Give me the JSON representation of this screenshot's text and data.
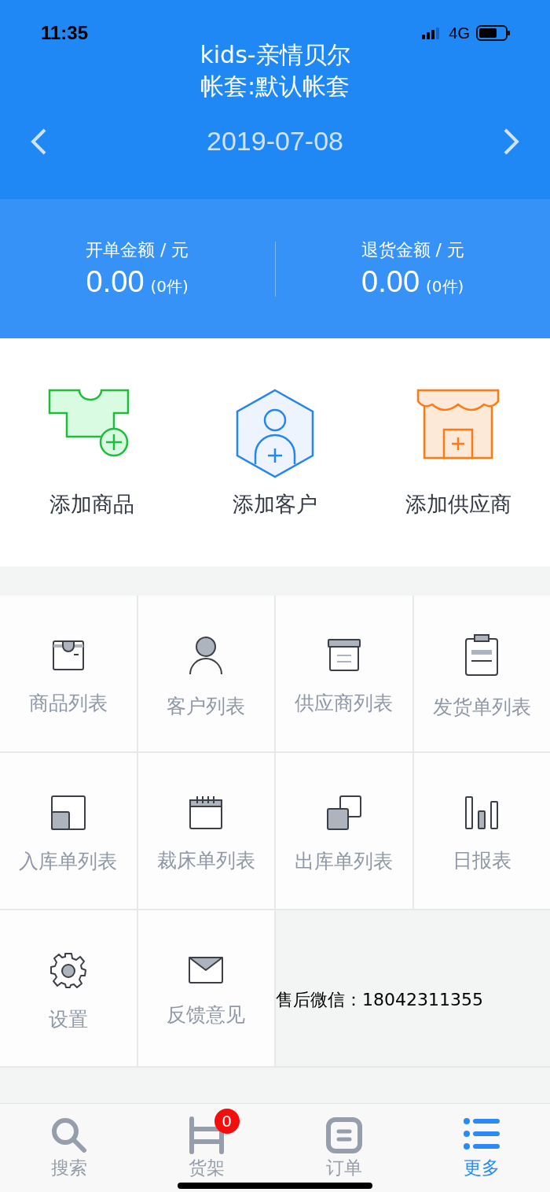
{
  "status_bar": {
    "time": "11:35",
    "network": "4G"
  },
  "header": {
    "title": "kids-亲情贝尔",
    "subtitle": "帐套:默认帐套",
    "date": "2019-07-08"
  },
  "summary": [
    {
      "label": "开单金额 / 元",
      "amount": "0.00",
      "count": "(0件)"
    },
    {
      "label": "退货金额 / 元",
      "amount": "0.00",
      "count": "(0件)"
    }
  ],
  "quick_actions": [
    {
      "kind": "shirt",
      "label": "添加商品"
    },
    {
      "kind": "customer",
      "label": "添加客户"
    },
    {
      "kind": "shop",
      "label": "添加供应商"
    }
  ],
  "menu": [
    {
      "kind": "product",
      "label": "商品列表"
    },
    {
      "kind": "person",
      "label": "客户列表"
    },
    {
      "kind": "archive",
      "label": "供应商列表"
    },
    {
      "kind": "clipboard",
      "label": "发货单列表"
    },
    {
      "kind": "inbound",
      "label": "入库单列表"
    },
    {
      "kind": "calendar",
      "label": "裁床单列表"
    },
    {
      "kind": "outbound",
      "label": "出库单列表"
    },
    {
      "kind": "bars",
      "label": "日报表"
    },
    {
      "kind": "gear",
      "label": "设置"
    },
    {
      "kind": "mail",
      "label": "反馈意见"
    }
  ],
  "contact": "售后微信：18042311355",
  "tabs": [
    {
      "kind": "search",
      "label": "搜索",
      "selected": false
    },
    {
      "kind": "shelf",
      "label": "货架",
      "selected": false,
      "badge": "0"
    },
    {
      "kind": "order",
      "label": "订单",
      "selected": false
    },
    {
      "kind": "list",
      "label": "更多",
      "selected": true
    }
  ]
}
